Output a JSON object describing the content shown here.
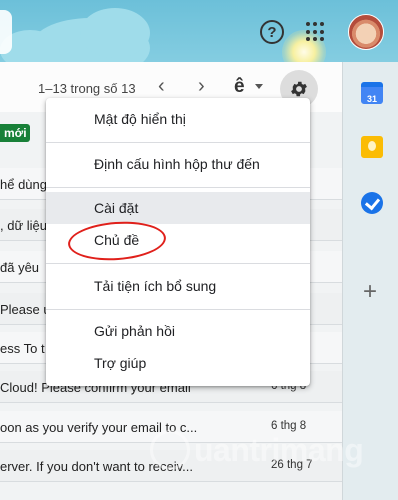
{
  "header": {
    "help_icon": "help-circle-icon",
    "help_glyph": "?",
    "apps_icon": "apps-grid-icon",
    "avatar_icon": "account-avatar"
  },
  "toolbar": {
    "page_range": "1–13 trong số 13",
    "prev_glyph": "‹",
    "next_glyph": "›",
    "input_tools_label": "ê",
    "settings_icon": "gear-icon"
  },
  "inbox": {
    "new_badge": "mới",
    "rows": [
      {
        "snippet": "hể dùng",
        "date": ""
      },
      {
        "snippet": ", dữ liệu",
        "date": ""
      },
      {
        "snippet": "đã yêu",
        "date": ""
      },
      {
        "snippet": "Please u",
        "date": ""
      },
      {
        "snippet": "ess To t",
        "date": ""
      },
      {
        "snippet": "Cloud! Please confirm your email",
        "date": "6 thg 8"
      },
      {
        "snippet": "oon as you verify your email to c...",
        "date": "6 thg 8"
      },
      {
        "snippet": "erver. If you don't want to receiv...",
        "date": "26 thg 7"
      }
    ]
  },
  "settings_menu": {
    "items": [
      {
        "label": "Mật độ hiển thị"
      },
      {
        "label": "Định cấu hình hộp thư đến"
      },
      {
        "label": "Cài đặt"
      },
      {
        "label": "Chủ đề"
      },
      {
        "label": "Tải tiện ích bổ sung"
      },
      {
        "label": "Gửi phản hồi"
      },
      {
        "label": "Trợ giúp"
      }
    ]
  },
  "side_panel": {
    "calendar_label": "31",
    "icons": [
      "calendar-icon",
      "keep-icon",
      "tasks-icon",
      "add-icon"
    ],
    "add_glyph": "+"
  },
  "watermark": {
    "text": "uantrimang"
  },
  "colors": {
    "accent_blue": "#4285f4",
    "new_badge_green": "#188038",
    "annotation_red": "#e0201b",
    "keep_yellow": "#fbbc04"
  }
}
